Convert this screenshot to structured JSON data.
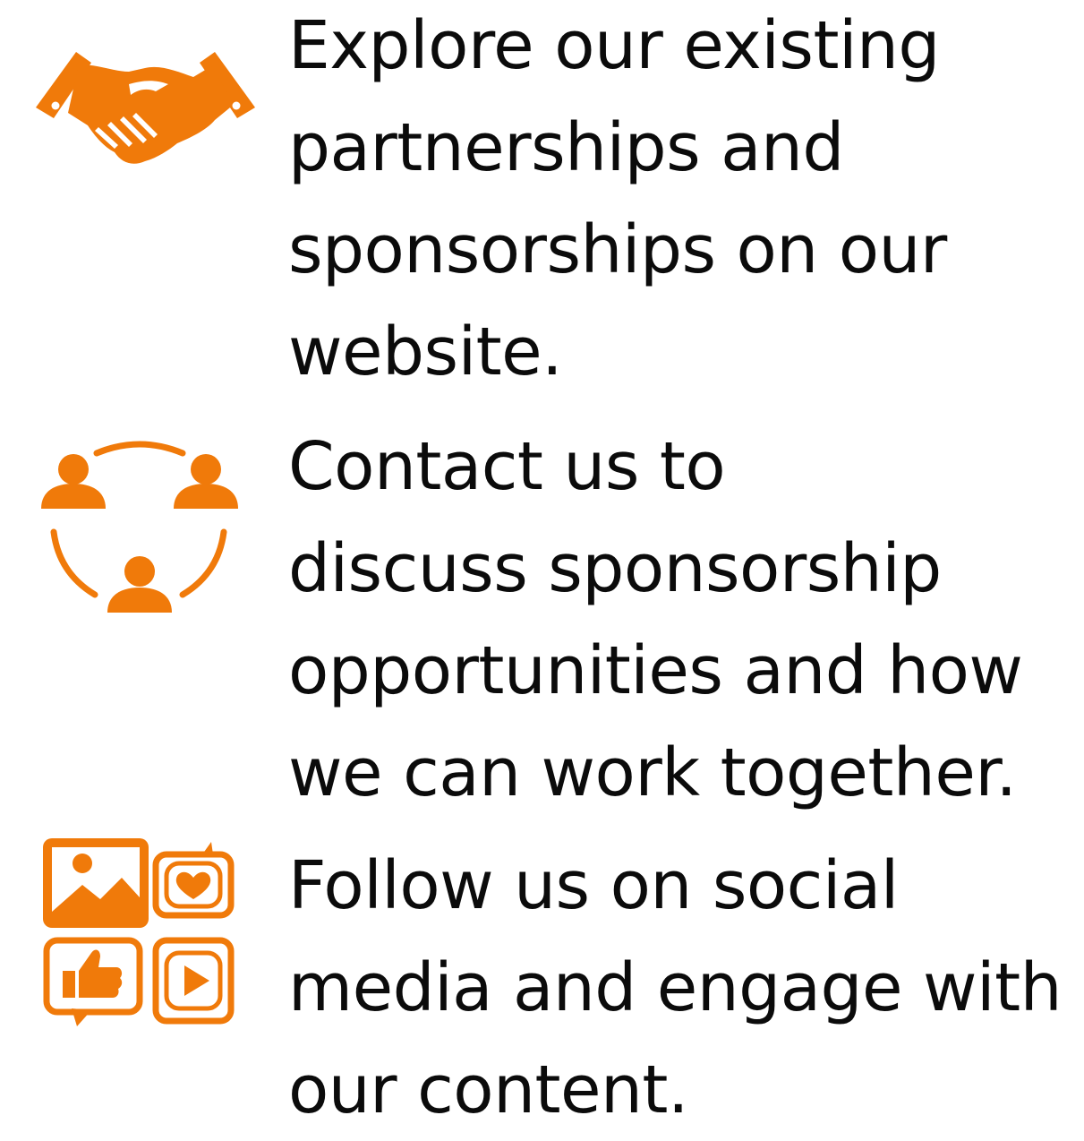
{
  "colors": {
    "accent": "#F07A0A",
    "text": "#0B0B0B",
    "background": "#FFFFFF"
  },
  "items": [
    {
      "icon": "handshake-icon",
      "lines": [
        "Explore our existing",
        "partnerships and",
        "sponsorships on our",
        "website."
      ]
    },
    {
      "icon": "people-network-icon",
      "lines": [
        "Contact us to",
        "discuss sponsorship",
        "opportunities and how",
        "we can work together."
      ]
    },
    {
      "icon": "social-media-icon",
      "lines": [
        "Follow us on social",
        "media and engage with",
        "our content."
      ]
    }
  ]
}
